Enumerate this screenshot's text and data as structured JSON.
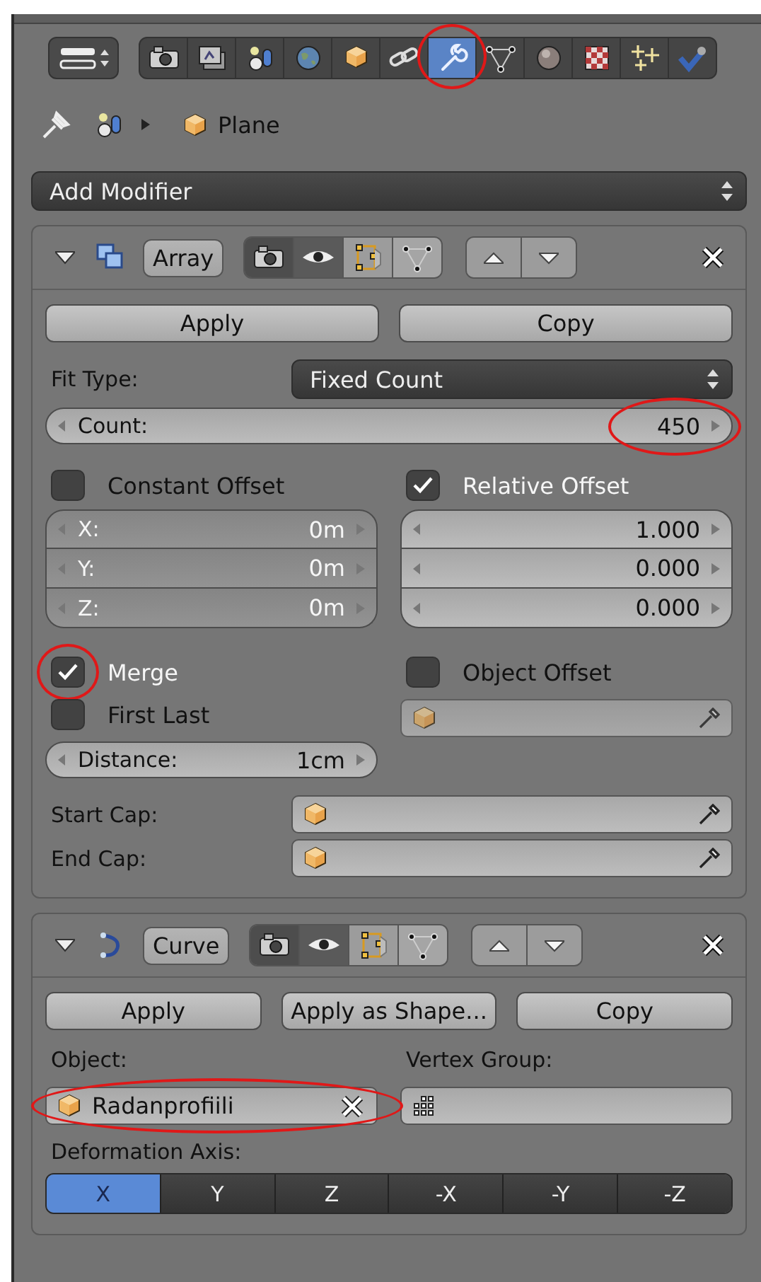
{
  "toolbar": {
    "tabs": [
      {
        "selected": false,
        "highlighted": false
      },
      {
        "selected": false,
        "highlighted": false
      },
      {
        "selected": false,
        "highlighted": false
      },
      {
        "selected": false,
        "highlighted": false
      },
      {
        "selected": false,
        "highlighted": false
      },
      {
        "selected": false,
        "highlighted": false
      },
      {
        "selected": true,
        "highlighted": true
      },
      {
        "selected": false,
        "highlighted": false
      },
      {
        "selected": false,
        "highlighted": false
      },
      {
        "selected": false,
        "highlighted": false
      },
      {
        "selected": false,
        "highlighted": false
      },
      {
        "selected": false,
        "highlighted": false
      }
    ]
  },
  "breadcrumb": {
    "object": "Plane"
  },
  "add_modifier": "Add Modifier",
  "modifiers": [
    {
      "kind": "array",
      "name": "Array",
      "expanded": true,
      "buttons": [
        "Apply",
        "Copy"
      ],
      "fit_type": {
        "label": "Fit Type:",
        "value": "Fixed Count"
      },
      "count": {
        "label": "Count:",
        "value": "450",
        "highlighted": true
      },
      "constant_offset": {
        "label": "Constant Offset",
        "checked": false,
        "fields": [
          {
            "label": "X:",
            "value": "0m"
          },
          {
            "label": "Y:",
            "value": "0m"
          },
          {
            "label": "Z:",
            "value": "0m"
          }
        ]
      },
      "relative_offset": {
        "label": "Relative Offset",
        "checked": true,
        "fields": [
          {
            "value": "1.000"
          },
          {
            "value": "0.000"
          },
          {
            "value": "0.000"
          }
        ]
      },
      "merge": {
        "label": "Merge",
        "checked": true,
        "highlighted": true
      },
      "first_last": {
        "label": "First Last",
        "checked": false
      },
      "object_offset": {
        "label": "Object Offset",
        "checked": false
      },
      "distance": {
        "label": "Distance:",
        "value": "1cm"
      },
      "caps": [
        {
          "label": "Start Cap:"
        },
        {
          "label": "End Cap:"
        }
      ]
    },
    {
      "kind": "curve",
      "name": "Curve",
      "expanded": true,
      "buttons": [
        "Apply",
        "Apply as Shape...",
        "Copy"
      ],
      "object": {
        "label": "Object:",
        "value": "Radanprofiili",
        "highlighted": true
      },
      "vertex_group": {
        "label": "Vertex Group:"
      },
      "deformation_axis": {
        "label": "Deformation Axis:",
        "options": [
          {
            "label": "X",
            "selected": true
          },
          {
            "label": "Y",
            "selected": false
          },
          {
            "label": "Z",
            "selected": false
          },
          {
            "label": "-X",
            "selected": false
          },
          {
            "label": "-Y",
            "selected": false
          },
          {
            "label": "-Z",
            "selected": false
          }
        ]
      }
    }
  ]
}
